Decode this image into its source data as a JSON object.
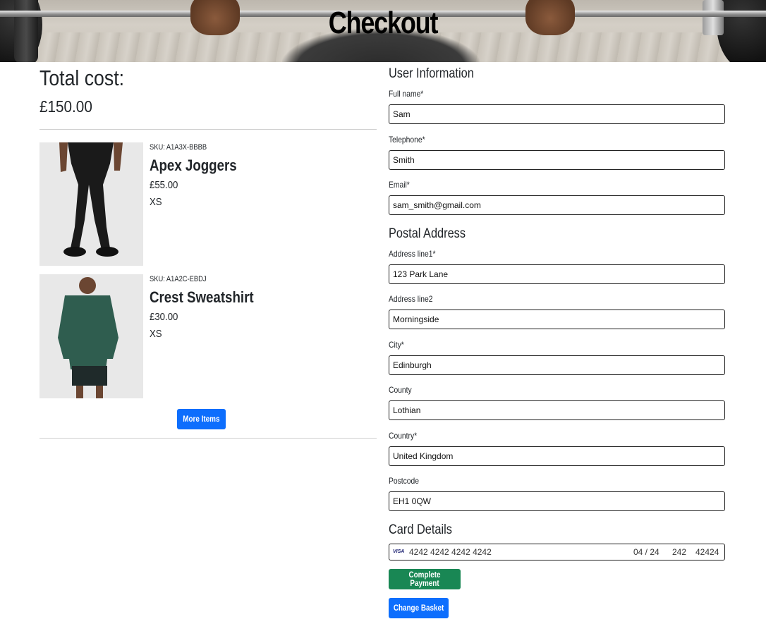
{
  "header": {
    "title": "Checkout"
  },
  "summary": {
    "total_label": "Total cost:",
    "total_value": "£150.00"
  },
  "items": [
    {
      "sku": "SKU: A1A3X-BBBB",
      "name": "Apex Joggers",
      "price": "£55.00",
      "size": "XS"
    },
    {
      "sku": "SKU: A1A2C-EBDJ",
      "name": "Crest Sweatshirt",
      "price": "£30.00",
      "size": "XS"
    }
  ],
  "more_items_label": "More Items",
  "user_info": {
    "heading": "User Information",
    "full_name": {
      "label": "Full name*",
      "value": "Sam"
    },
    "telephone": {
      "label": "Telephone*",
      "value": "Smith"
    },
    "email": {
      "label": "Email*",
      "value": "sam_smith@gmail.com"
    }
  },
  "postal": {
    "heading": "Postal Address",
    "line1": {
      "label": "Address line1*",
      "value": "123 Park Lane"
    },
    "line2": {
      "label": "Address line2",
      "value": "Morningside"
    },
    "city": {
      "label": "City*",
      "value": "Edinburgh"
    },
    "county": {
      "label": "County",
      "value": "Lothian"
    },
    "country": {
      "label": "Country*",
      "value": "United Kingdom"
    },
    "postcode": {
      "label": "Postcode",
      "value": "EH1 0QW"
    }
  },
  "card": {
    "heading": "Card Details",
    "brand": "VISA",
    "number": "4242 4242 4242 4242",
    "expiry": "04 / 24",
    "cvc": "242",
    "zip": "42424"
  },
  "actions": {
    "complete_label": "Complete Payment",
    "change_label": "Change Basket"
  },
  "colors": {
    "primary": "#0d6efd",
    "success": "#198754"
  }
}
